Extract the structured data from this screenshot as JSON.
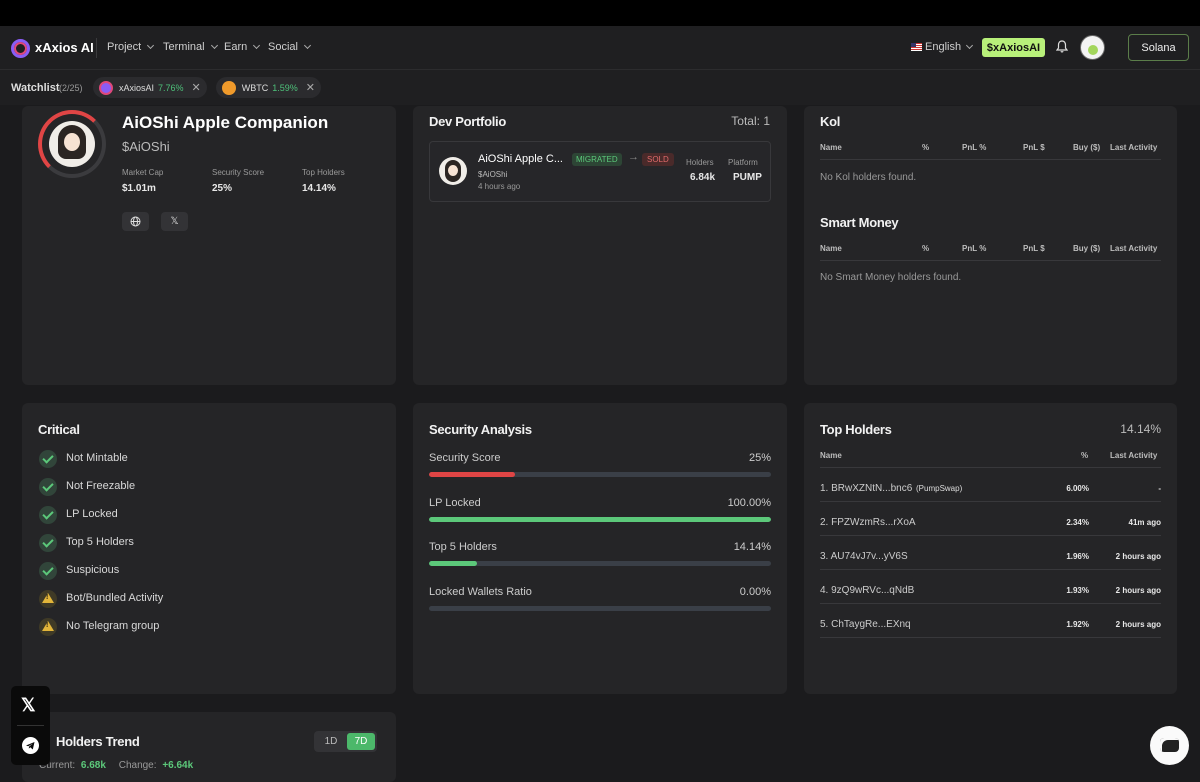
{
  "app": {
    "brand": "xAxios AI"
  },
  "nav": {
    "items": [
      "Project",
      "Terminal",
      "Earn",
      "Social"
    ],
    "language": "English",
    "ticker_button": "$xAxiosAI",
    "chain": "Solana"
  },
  "watchlist": {
    "label": "Watchlist",
    "count": "(2/25)",
    "items": [
      {
        "symbol": "xAxiosAI",
        "change": "7.76%"
      },
      {
        "symbol": "WBTC",
        "change": "1.59%"
      }
    ]
  },
  "token": {
    "name": "AiOShi Apple Companion",
    "ticker": "$AiOShi",
    "security_score_ring": 0.25,
    "stats": [
      {
        "label": "Market Cap",
        "value": "$1.01m"
      },
      {
        "label": "Security Score",
        "value": "25%"
      },
      {
        "label": "Top Holders",
        "value": "14.14%"
      }
    ],
    "links": [
      "globe-icon",
      "x-icon"
    ]
  },
  "dev_portfolio": {
    "title": "Dev Portfolio",
    "total": "Total: 1",
    "item": {
      "name": "AiOShi Apple C...",
      "badge_migrated": "MIGRATED",
      "arrow": "→",
      "badge_sold": "SOLD",
      "ticker": "$AiOShi",
      "time": "4 hours ago",
      "holders_label": "Holders",
      "holders_value": "6.84k",
      "platform_label": "Platform",
      "platform_value": "PUMP"
    }
  },
  "kol": {
    "title": "Kol",
    "headers": [
      "Name",
      "%",
      "PnL %",
      "PnL $",
      "Buy ($)",
      "Last Activity"
    ],
    "empty": "No Kol holders found."
  },
  "smart_money": {
    "title": "Smart Money",
    "headers": [
      "Name",
      "%",
      "PnL %",
      "PnL $",
      "Buy ($)",
      "Last Activity"
    ],
    "empty": "No Smart Money holders found."
  },
  "critical": {
    "title": "Critical",
    "items": [
      {
        "label": "Not Mintable",
        "status": "ok"
      },
      {
        "label": "Not Freezable",
        "status": "ok"
      },
      {
        "label": "LP Locked",
        "status": "ok"
      },
      {
        "label": "Top 5 Holders",
        "status": "ok"
      },
      {
        "label": "Suspicious",
        "status": "ok"
      },
      {
        "label": "Bot/Bundled Activity",
        "status": "warn"
      },
      {
        "label": "No Telegram group",
        "status": "warn"
      }
    ]
  },
  "security": {
    "title": "Security Analysis",
    "rows": [
      {
        "label": "Security Score",
        "value": "25%",
        "fraction": 0.25,
        "color": "#e04545"
      },
      {
        "label": "LP Locked",
        "value": "100.00%",
        "fraction": 1.0,
        "color": "#5cc87a"
      },
      {
        "label": "Top 5 Holders",
        "value": "14.14%",
        "fraction": 0.1414,
        "color": "#5cc87a"
      },
      {
        "label": "Locked Wallets Ratio",
        "value": "0.00%",
        "fraction": 0.0,
        "color": "#5cc87a"
      }
    ]
  },
  "top_holders": {
    "title": "Top Holders",
    "total": "14.14%",
    "headers": [
      "Name",
      "%",
      "Last Activity"
    ],
    "rows": [
      {
        "name": "1. BRwXZNtN...bnc6",
        "tag": "(PumpSwap)",
        "pct": "6.00%",
        "last": "-"
      },
      {
        "name": "2. FPZWzmRs...rXoA",
        "tag": "",
        "pct": "2.34%",
        "last": "41m ago"
      },
      {
        "name": "3. AU74vJ7v...yV6S",
        "tag": "",
        "pct": "1.96%",
        "last": "2 hours ago"
      },
      {
        "name": "4. 9zQ9wRVc...qNdB",
        "tag": "",
        "pct": "1.93%",
        "last": "2 hours ago"
      },
      {
        "name": "5. ChTaygRe...EXnq",
        "tag": "",
        "pct": "1.92%",
        "last": "2 hours ago"
      }
    ]
  },
  "holders_trend": {
    "title": "Holders Trend",
    "ranges": [
      "1D",
      "7D"
    ],
    "active_range": "7D",
    "current_label": "Current:",
    "current_value": "6.68k",
    "change_label": "Change:",
    "change_value": "+6.64k"
  },
  "colors": {
    "accent": "#b8f07a",
    "positive": "#5cc87a",
    "negative": "#e04545"
  }
}
